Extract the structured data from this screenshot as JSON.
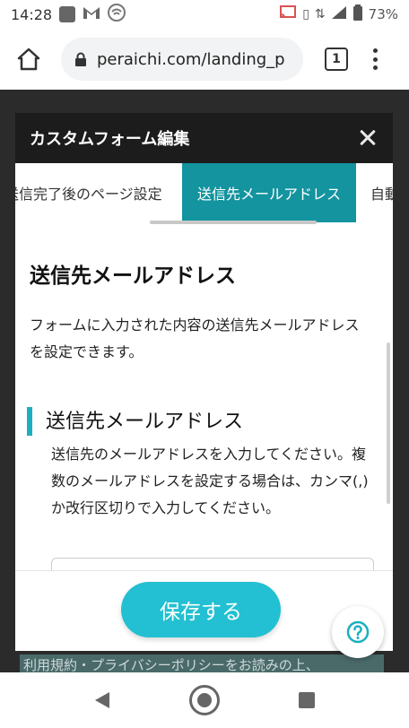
{
  "status_bar": {
    "time": "14:28",
    "battery": "73%",
    "icons": [
      "notification-square-icon",
      "gmail-icon",
      "wifi-icon",
      "cast-icon",
      "vibrate-icon",
      "data-arrows-icon",
      "signal-icon",
      "battery-icon"
    ]
  },
  "browser": {
    "url": "peraichi.com/landing_p",
    "tab_count": "1"
  },
  "modal": {
    "title": "カスタムフォーム編集",
    "tabs": [
      {
        "label": "送信完了後のページ設定"
      },
      {
        "label": "送信先メールアドレス",
        "active": true
      },
      {
        "label": "自動"
      }
    ],
    "section": {
      "title": "送信先メールアドレス",
      "description": "フォームに入力された内容の送信先メールアドレスを設定できます。"
    },
    "subsection": {
      "title": "送信先メールアドレス",
      "description": "送信先のメールアドレスを入力してください。複数のメールアドレスを設定する場合は、カンマ(,)か改行区切りで入力してください。"
    },
    "save_label": "保存する"
  },
  "background": {
    "terms_text": "利用規約・プライバシーポリシーをお読みの上、"
  },
  "colors": {
    "accent": "#13949f",
    "save_button": "#22c0d2",
    "modal_header": "#1c1c1c"
  }
}
